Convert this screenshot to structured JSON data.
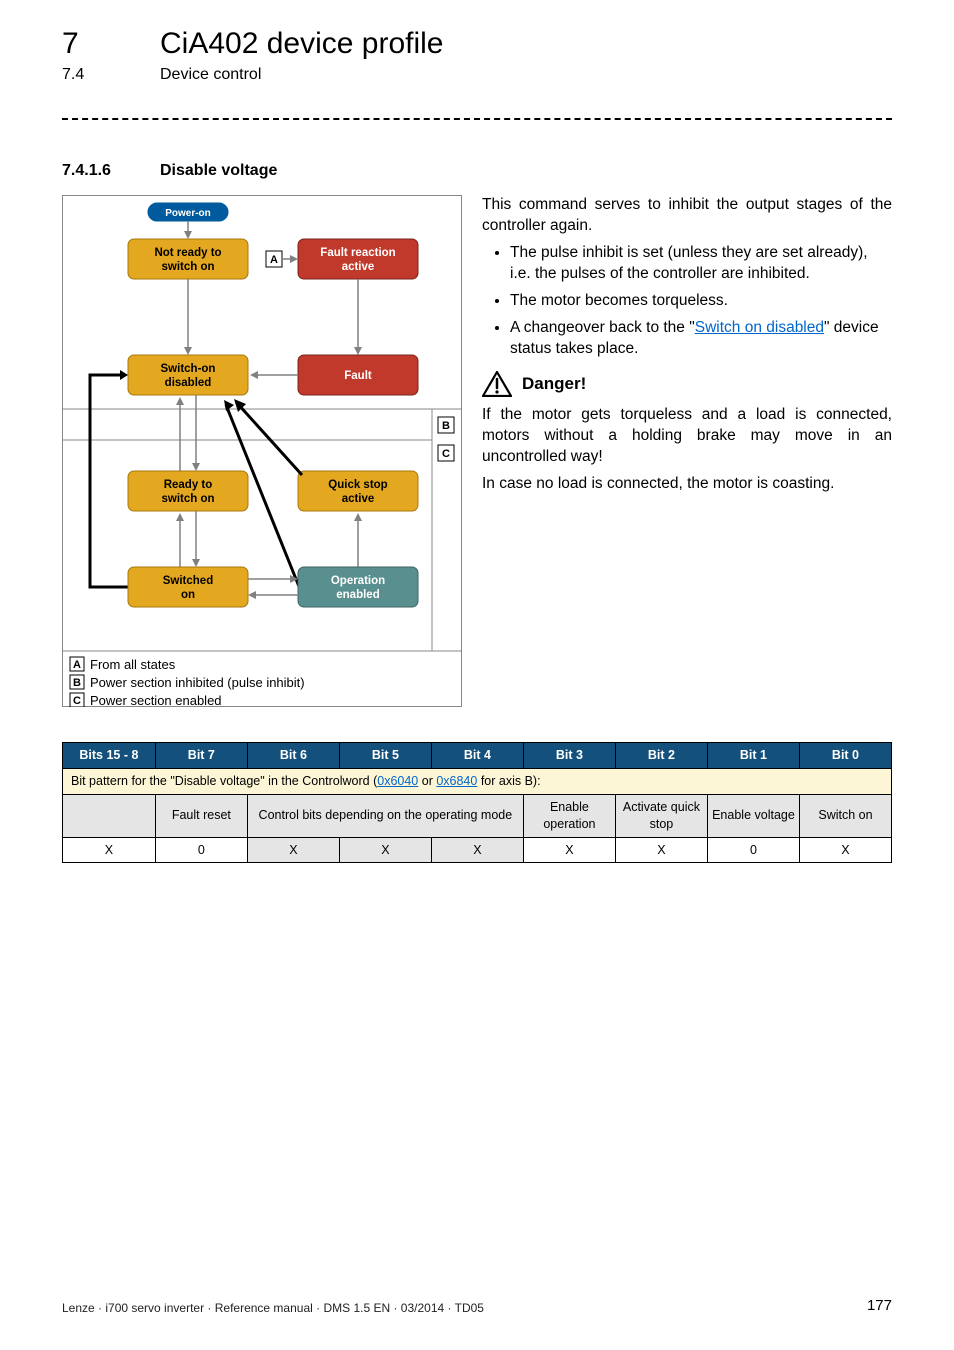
{
  "header": {
    "chapter_number": "7",
    "chapter_title": "CiA402 device profile",
    "section_number": "7.4",
    "section_title": "Device control"
  },
  "section": {
    "number": "7.4.1.6",
    "title": "Disable voltage"
  },
  "diagram": {
    "states": {
      "power_on": "Power-on",
      "not_ready_l1": "Not ready to",
      "not_ready_l2": "switch on",
      "fault_reaction_l1": "Fault reaction",
      "fault_reaction_l2": "active",
      "switch_on_disabled_l1": "Switch-on",
      "switch_on_disabled_l2": "disabled",
      "fault": "Fault",
      "ready_l1": "Ready to",
      "ready_l2": "switch on",
      "quick_stop_l1": "Quick stop",
      "quick_stop_l2": "active",
      "switched_on_l1": "Switched",
      "switched_on_l2": "on",
      "op_enabled_l1": "Operation",
      "op_enabled_l2": "enabled"
    },
    "tags": {
      "a": "A",
      "b": "B",
      "c": "C"
    },
    "legend": {
      "a": "From all states",
      "b": "Power section inhibited (pulse inhibit)",
      "c": "Power section enabled"
    }
  },
  "right": {
    "intro": "This command serves to inhibit the output stages of the controller again.",
    "bullets": [
      "The pulse inhibit is set (unless they are set already), i.e. the pulses of the controller are inhibited.",
      "The motor becomes torqueless."
    ],
    "bullet3_pre": "A changeover back to the \"",
    "bullet3_link": "Switch on disabled",
    "bullet3_post": "\" device status takes place.",
    "danger_label": "Danger!",
    "danger_p1": "If the motor gets torqueless and a load is connected, motors without a holding brake may move in an uncontrolled way!",
    "danger_p2": "In case no load is connected, the motor is coasting."
  },
  "table": {
    "caption_pre": "Bit pattern for the \"Disable voltage\" in the Controlword (",
    "link1": "0x6040",
    "mid": " or ",
    "link2": "0x6840",
    "caption_post": " for axis B):",
    "headers": [
      "Bits 15 - 8",
      "Bit 7",
      "Bit 6",
      "Bit 5",
      "Bit 4",
      "Bit 3",
      "Bit 2",
      "Bit 1",
      "Bit 0"
    ],
    "row_desc": {
      "c0": "",
      "c1": "Fault reset",
      "c2_4": "Control bits depending on the operating mode",
      "c5": "Enable operation",
      "c6": "Activate quick stop",
      "c7": "Enable voltage",
      "c8": "Switch on"
    },
    "row_vals": [
      "X",
      "0",
      "X",
      "X",
      "X",
      "X",
      "X",
      "0",
      "X"
    ]
  },
  "footer": {
    "text": "Lenze · i700 servo inverter · Reference manual · DMS 1.5 EN · 03/2014 · TD05",
    "page": "177"
  }
}
